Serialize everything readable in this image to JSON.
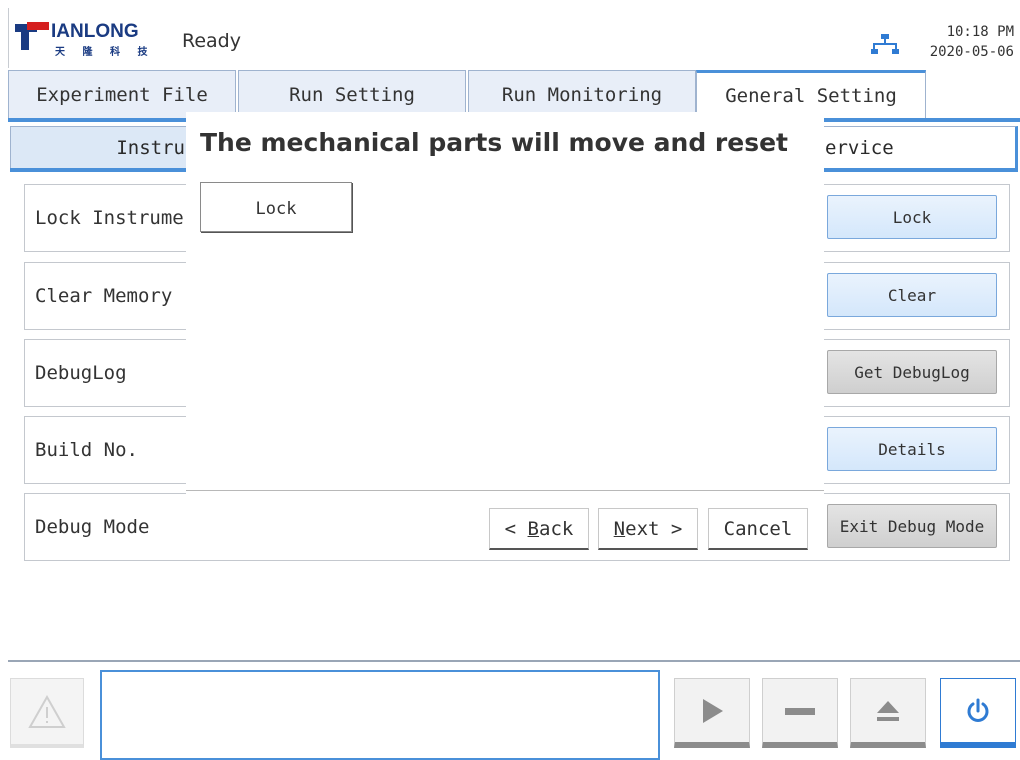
{
  "header": {
    "brand": "IANLONG",
    "brand_sub": "天 隆 科 技",
    "status": "Ready",
    "time": "10:18 PM",
    "date": "2020-05-06"
  },
  "tabs": [
    {
      "label": "Experiment File"
    },
    {
      "label": "Run Setting"
    },
    {
      "label": "Run Monitoring"
    },
    {
      "label": "General Setting"
    }
  ],
  "subtabs": {
    "left_partial": "Instru",
    "right_partial": "ervice"
  },
  "rows": [
    {
      "label": "Lock Instrume",
      "button": "Lock"
    },
    {
      "label": "Clear Memory",
      "button": "Clear"
    },
    {
      "label": "DebugLog",
      "button": "Get DebugLog"
    },
    {
      "label": "Build No.",
      "button": "Details"
    },
    {
      "label": "Debug Mode",
      "button": "Exit Debug Mode"
    }
  ],
  "wizard": {
    "title": "The mechanical parts will move and reset",
    "lock_button": "Lock",
    "back_prefix": "< ",
    "back_underlined": "B",
    "back_rest": "ack",
    "next_underlined": "N",
    "next_rest": "ext >",
    "cancel": "Cancel"
  },
  "colors": {
    "accent": "#4a90d9",
    "brand_blue": "#1a3b82",
    "brand_red": "#d51f1f",
    "power_blue": "#2f7bd3"
  },
  "icons": {
    "warning": "warning-icon",
    "play": "play-icon",
    "stop": "stop-icon",
    "eject": "eject-icon",
    "power": "power-icon",
    "network": "network-icon"
  }
}
